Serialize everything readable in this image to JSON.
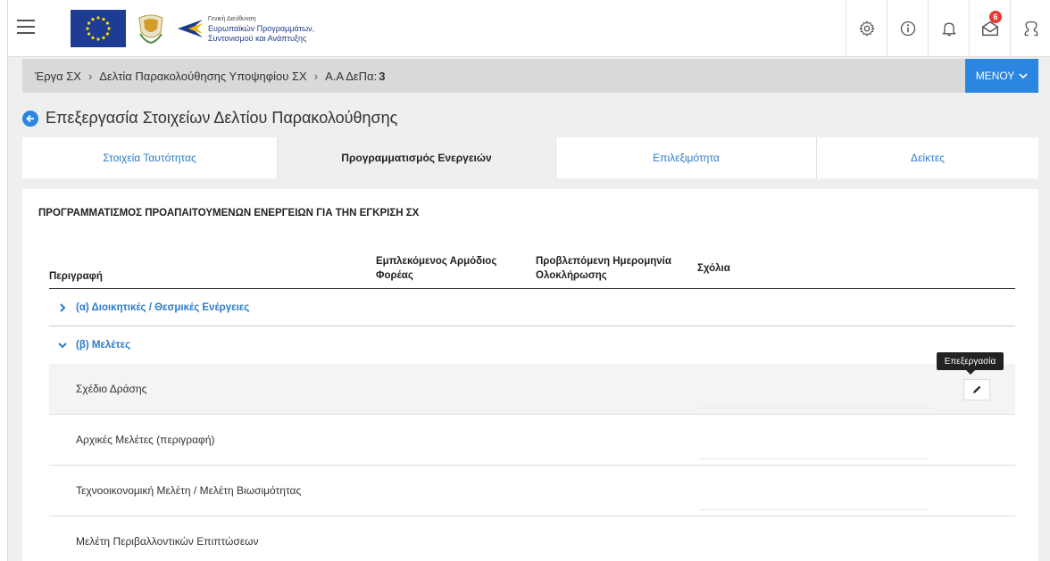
{
  "header": {
    "logo_line1": "Γενική Διεύθυνση",
    "logo_line2": "Ευρωπαϊκών Προγραμμάτων,",
    "logo_line3": "Συντονισμού και Ανάπτυξης",
    "notification_count": "6",
    "icons": [
      "menu-icon",
      "settings-icon",
      "info-icon",
      "bell-icon",
      "mail-icon",
      "user-icon"
    ]
  },
  "breadcrumb": {
    "item1": "Έργα ΣΧ",
    "item2": "Δελτία Παρακολούθησης Υποψηφίου ΣΧ",
    "item3_label": "Α.Α ΔεΠα:",
    "item3_value": "3",
    "menu_label": "ΜΕΝΟΥ"
  },
  "page": {
    "title": "Επεξεργασία Στοιχείων Δελτίου Παρακολούθησης"
  },
  "tabs": [
    {
      "label": "Στοιχεία Ταυτότητας"
    },
    {
      "label": "Προγραμματισμός Ενεργειών"
    },
    {
      "label": "Επιλεξιμότητα"
    },
    {
      "label": "Δείκτες"
    }
  ],
  "section": {
    "title": "ΠΡΟΓΡΑΜΜΑΤΙΣΜΟΣ ΠΡΟΑΠΑΙΤΟΥΜΕΝΩΝ ΕΝΕΡΓΕΙΩΝ ΓΙΑ ΤΗΝ ΕΓΚΡΙΣΗ ΣΧ"
  },
  "table": {
    "headers": {
      "description": "Περιγραφή",
      "agency_line1": "Εμπλεκόμενος Αρμόδιος",
      "agency_line2": "Φορέας",
      "date_line1": "Προβλεπόμενη Ημερομηνία",
      "date_line2": "Ολοκλήρωσης",
      "comments": "Σχόλια"
    },
    "groups": [
      {
        "label": "(α) Διοικητικές / Θεσμικές Ενέργειες",
        "expanded": false
      },
      {
        "label": "(β) Μελέτες",
        "expanded": true
      }
    ],
    "rows": [
      {
        "label": "Σχέδιο Δράσης"
      },
      {
        "label": "Αρχικές Μελέτες (περιγραφή)"
      },
      {
        "label": "Τεχνοοικονομική Μελέτη / Μελέτη Βιωσιμότητας"
      },
      {
        "label": "Μελέτη Περιβαλλοντικών Επιπτώσεων"
      }
    ],
    "tooltip": "Επεξεργασία"
  },
  "colors": {
    "accent": "#2b86e2",
    "link": "#2b7bcb",
    "badge": "#e53935"
  }
}
